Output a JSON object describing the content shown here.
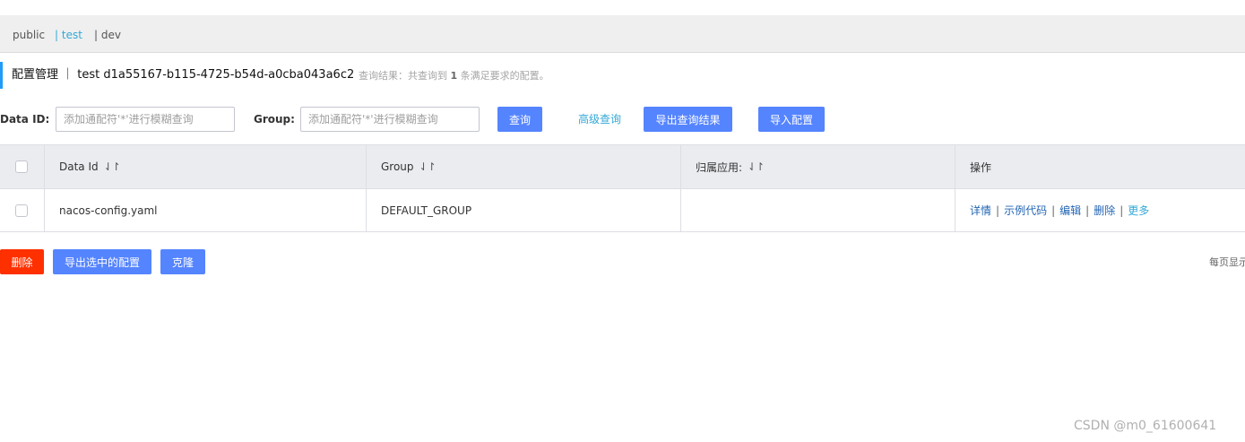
{
  "namespaces": [
    {
      "label": "public",
      "active": false
    },
    {
      "label": "| test",
      "active": true
    },
    {
      "label": "| dev",
      "active": false
    }
  ],
  "header": {
    "title": "配置管理 ｜ test  d1a55167-b115-4725-b54d-a0cba043a6c2",
    "result_prefix": "查询结果：共查询到",
    "result_count": "1",
    "result_suffix": "条满足要求的配置。"
  },
  "filters": {
    "data_id_label": "Data ID:",
    "data_id_placeholder": "添加通配符'*'进行模糊查询",
    "data_id_value": "",
    "group_label": "Group:",
    "group_placeholder": "添加通配符'*'进行模糊查询",
    "group_value": "",
    "query_button": "查询",
    "advanced_query": "高级查询",
    "export_results_button": "导出查询结果",
    "import_button": "导入配置"
  },
  "table": {
    "columns": [
      "Data Id",
      "Group",
      "归属应用:",
      "操作"
    ],
    "sort_icon": "⇃↾",
    "rows": [
      {
        "data_id": "nacos-config.yaml",
        "group": "DEFAULT_GROUP",
        "app": "",
        "actions": [
          "详情",
          "示例代码",
          "编辑",
          "删除",
          "更多"
        ]
      }
    ]
  },
  "bulk_actions": {
    "delete": "删除",
    "export_selected": "导出选中的配置",
    "clone": "克隆"
  },
  "pagination": {
    "page_size_label": "每页显示"
  },
  "watermark": "CSDN @m0_61600641",
  "colors": {
    "primary": "#5584ff",
    "danger": "#ff3000",
    "link": "#33a8d6",
    "action_link": "#2265b4",
    "header_accent": "#209bfa"
  }
}
